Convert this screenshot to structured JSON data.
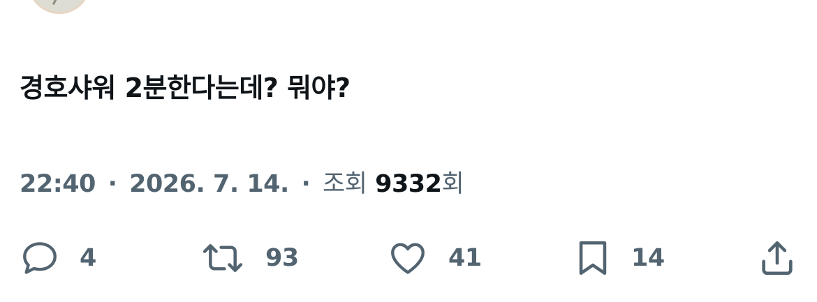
{
  "tweet": {
    "text": "경호샤워 2분한다는데? 뭐야?"
  },
  "meta": {
    "time": "22:40",
    "separator": "·",
    "date": "2026. 7. 14.",
    "views_label": "조회",
    "views_count": "9332",
    "views_suffix": "회"
  },
  "actions": {
    "reply": {
      "icon": "reply-icon",
      "count": "4"
    },
    "retweet": {
      "icon": "retweet-icon",
      "count": "93"
    },
    "like": {
      "icon": "heart-icon",
      "count": "41"
    },
    "bookmark": {
      "icon": "bookmark-icon",
      "count": "14"
    },
    "share": {
      "icon": "share-icon"
    }
  },
  "colors": {
    "text_primary": "#0f1419",
    "text_secondary": "#536471",
    "background": "#ffffff"
  }
}
